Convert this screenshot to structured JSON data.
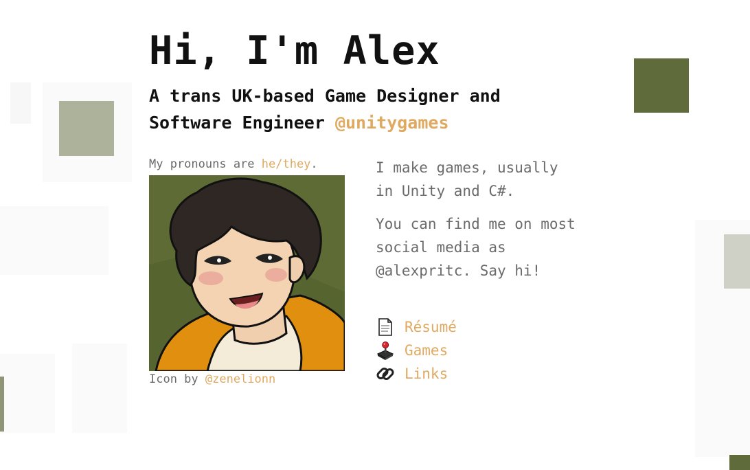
{
  "header": {
    "title": "Hi, I'm Alex",
    "subtitle_main": "A trans UK-based Game Designer and Software Engineer ",
    "subtitle_handle": "@unitygames"
  },
  "profile": {
    "pronouns_prefix": "My pronouns are ",
    "pronouns_value": "he/they",
    "pronouns_suffix": ".",
    "avatar_alt": "Illustrated portrait of Alex",
    "credit_prefix": "Icon by ",
    "credit_handle": "@zenelionn"
  },
  "bio": {
    "paragraph1": "I make games, usually in Unity and C#.",
    "paragraph2": "You can find me on most social media as @alexpritc. Say hi!"
  },
  "links": [
    {
      "label": "Résumé",
      "icon": "document-icon"
    },
    {
      "label": "Games",
      "icon": "joystick-icon"
    },
    {
      "label": "Links",
      "icon": "link-icon"
    }
  ],
  "colors": {
    "accent": "#e0a960",
    "olive_dark": "#5f6b3a",
    "olive_light": "#adb29b",
    "grey_light": "#cfd1c6",
    "text_muted": "#6b6b6b"
  }
}
